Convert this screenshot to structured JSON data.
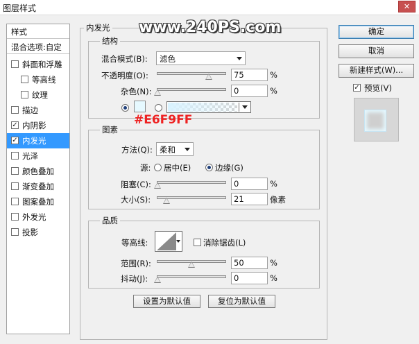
{
  "window": {
    "title": "图层样式",
    "close_glyph": "✕"
  },
  "sidebar": {
    "header_styles": "样式",
    "header_blend": "混合选项:自定",
    "items": [
      {
        "label": "斜面和浮雕",
        "checked": false
      },
      {
        "label": "等高线",
        "checked": false
      },
      {
        "label": "纹理",
        "checked": false
      },
      {
        "label": "描边",
        "checked": false
      },
      {
        "label": "内阴影",
        "checked": true
      },
      {
        "label": "内发光",
        "checked": true
      },
      {
        "label": "光泽",
        "checked": false
      },
      {
        "label": "颜色叠加",
        "checked": false
      },
      {
        "label": "渐变叠加",
        "checked": false
      },
      {
        "label": "图案叠加",
        "checked": false
      },
      {
        "label": "外发光",
        "checked": false
      },
      {
        "label": "投影",
        "checked": false
      }
    ],
    "check_glyph": "✓"
  },
  "panel": {
    "title": "内发光",
    "structure": {
      "title": "结构",
      "blend_mode_label": "混合模式(B):",
      "blend_mode_value": "滤色",
      "opacity_label": "不透明度(O):",
      "opacity_value": "75",
      "noise_label": "杂色(N):",
      "noise_value": "0",
      "percent": "%",
      "glow_color": "#e6f9ff"
    },
    "elements": {
      "title": "图素",
      "technique_label": "方法(Q):",
      "technique_value": "柔和",
      "source_label": "源:",
      "source_center": "居中(E)",
      "source_edge": "边缘(G)",
      "choke_label": "阻塞(C):",
      "choke_value": "0",
      "size_label": "大小(S):",
      "size_value": "21",
      "size_unit": "像素"
    },
    "quality": {
      "title": "品质",
      "contour_label": "等高线:",
      "antialias_label": "消除锯齿(L)",
      "range_label": "范围(R):",
      "range_value": "50",
      "jitter_label": "抖动(J):",
      "jitter_value": "0"
    },
    "make_default": "设置为默认值",
    "reset_default": "复位为默认值"
  },
  "buttons": {
    "ok": "确定",
    "cancel": "取消",
    "new_style": "新建样式(W)...",
    "preview_label": "预览(V)"
  },
  "overlay": {
    "watermark": "www.240PS.com",
    "color_hex": "#E6F9FF"
  }
}
